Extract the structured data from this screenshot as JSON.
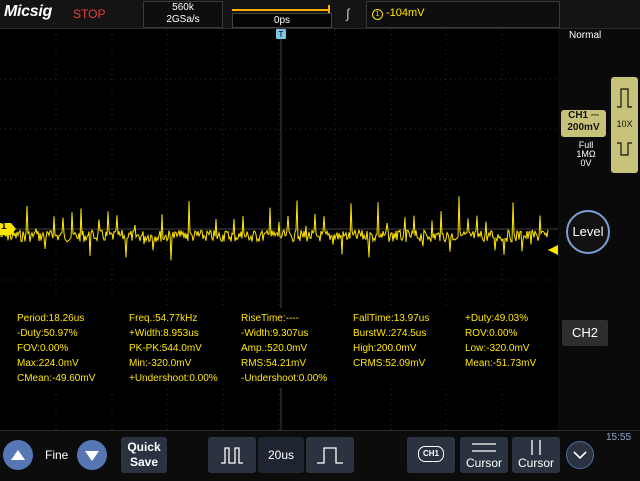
{
  "header": {
    "brand": "Micsig",
    "run_state": "STOP",
    "memory_depth": "560k",
    "sample_rate": "2GSa/s",
    "time_offset": "0ps",
    "trigger_channel": "1",
    "trigger_level": "-104mV",
    "acquisition_mode": "Normal"
  },
  "channel1": {
    "label": "CH1",
    "scale": "200mV",
    "bandwidth": "Full",
    "impedance": "1MΩ",
    "offset": "0V",
    "probe_ratio": "10X",
    "marker": "1"
  },
  "measurements": [
    [
      "Period:18.26us",
      "Freq.:54.77kHz",
      "RiseTime:----",
      "FallTime:13.97us",
      "+Duty:49.03%"
    ],
    [
      "-Duty:50.97%",
      "+Width:8.953us",
      "-Width:9.307us",
      "BurstW.:274.5us",
      "ROV:0.00%"
    ],
    [
      "FOV:0.00%",
      "PK-PK:544.0mV",
      "Amp.:520.0mV",
      "High:200.0mV",
      "Low:-320.0mV"
    ],
    [
      "Max:224.0mV",
      "Min:-320.0mV",
      "RMS:54.21mV",
      "CRMS:52.09mV",
      "Mean:-51.73mV"
    ],
    [
      "CMean:-49.60mV",
      "+Undershoot:0.00%",
      "-Undershoot:0.00%"
    ]
  ],
  "right_panel": {
    "level_label": "Level",
    "ch2_label": "CH2"
  },
  "bottom": {
    "fine_label": "Fine",
    "quick_save_line1": "Quick",
    "quick_save_line2": "Save",
    "timebase": "20us",
    "ch1_icon_label": "CH1",
    "cursor1_label": "Cursor",
    "cursor2_label": "Cursor",
    "clock": "15:55"
  },
  "colors": {
    "ch1": "#ffe600",
    "stop": "#e83b3b",
    "trigger": "#ffb000",
    "button": "#2b3340",
    "accent": "#5677b4"
  }
}
